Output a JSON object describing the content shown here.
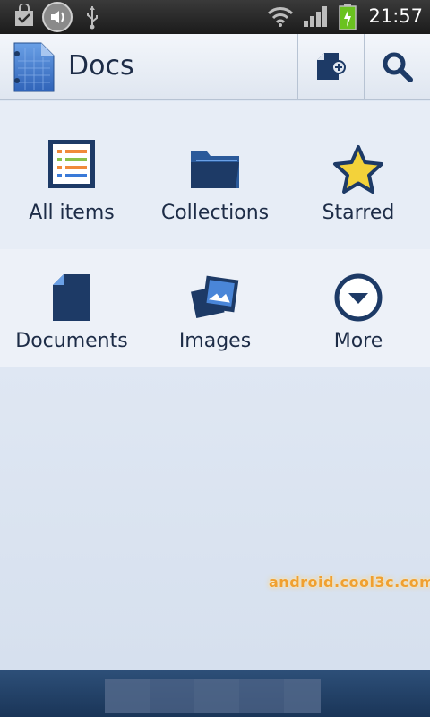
{
  "status_bar": {
    "time": "21:57",
    "icons": [
      "notification-bag-icon",
      "volume-icon",
      "usb-icon",
      "wifi-icon",
      "signal-icon",
      "battery-charging-icon"
    ]
  },
  "action_bar": {
    "title": "Docs",
    "app_icon": "docs-app-icon",
    "actions": [
      "new-document-icon",
      "search-icon"
    ]
  },
  "grid": {
    "items": [
      {
        "label": "All items",
        "icon": "list-icon"
      },
      {
        "label": "Collections",
        "icon": "folder-icon"
      },
      {
        "label": "Starred",
        "icon": "star-icon"
      },
      {
        "label": "Documents",
        "icon": "document-icon"
      },
      {
        "label": "Images",
        "icon": "images-icon"
      },
      {
        "label": "More",
        "icon": "more-down-icon"
      }
    ]
  },
  "watermark": "android.cool3c.com",
  "colors": {
    "accent": "#1d3a66",
    "title_text": "#1d2c47",
    "star": "#f3d23a"
  }
}
